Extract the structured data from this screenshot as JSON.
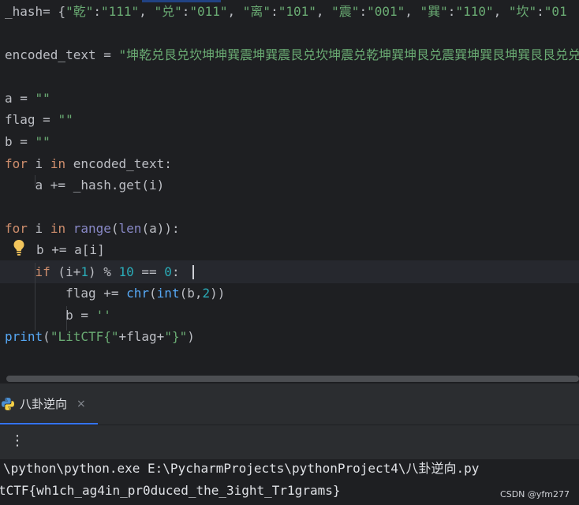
{
  "editor": {
    "lines": {
      "l1": {
        "var": "_hash",
        "op": "= {",
        "k1": "\"乾\"",
        "v1": "\"111\"",
        "k2": "\"兑\"",
        "v2": "\"011\"",
        "k3": "\"离\"",
        "v3": "\"101\"",
        "k4": "\"震\"",
        "v4": "\"001\"",
        "k5": "\"巽\"",
        "v5": "\"110\"",
        "k6": "\"坎\"",
        "v6": "\"01"
      },
      "l2": {
        "var": "encoded_text",
        "op": " = ",
        "value": "\"坤乾兑艮兑坎坤坤巽震坤巽震艮兑坎坤震兑乾坤巽坤艮兑震巽坤巽艮坤巽艮艮兑兑"
      },
      "l3": {
        "var": "a",
        "op": " = ",
        "value": "\"\""
      },
      "l4": {
        "var": "flag",
        "op": " = ",
        "value": "\"\""
      },
      "l5": {
        "var": "b",
        "op": " = ",
        "value": "\"\""
      },
      "l6": {
        "kw1": "for",
        "var": " i ",
        "kw2": "in",
        "rest": " encoded_text:"
      },
      "l7": {
        "text": "    a += _hash.get(i)"
      },
      "l8": {
        "kw1": "for",
        "var": " i ",
        "kw2": "in",
        "sp": " ",
        "fn1": "range",
        "p1": "(",
        "fn2": "len",
        "rest": "(a)):"
      },
      "l9": {
        "text": "b += a[i]"
      },
      "l10": {
        "indent": "    ",
        "kw": "if",
        "p1": " (i+",
        "n1": "1",
        "p2": ") % ",
        "n2": "10",
        "p3": " == ",
        "n3": "0",
        "p4": ":"
      },
      "l11": {
        "indent": "        flag += ",
        "fn1": "chr",
        "p1": "(",
        "fn2": "int",
        "p2": "(b,",
        "n1": "2",
        "p3": "))"
      },
      "l12": {
        "indent": "        b = ",
        "value": "''"
      },
      "l13": {
        "fn": "print",
        "p1": "(",
        "s1": "\"LitCTF{\"",
        "p2": "+flag+",
        "s2": "\"}\"",
        "p3": ")"
      }
    }
  },
  "run_panel": {
    "tab_label": "八卦逆向",
    "tab_close": "×",
    "menu_glyph": "⋮",
    "console_lines": [
      "\\python\\python.exe E:\\PycharmProjects\\pythonProject4\\八卦逆向.py",
      "tCTF{wh1ch_ag4in_pr0duced_the_3ight_Tr1grams}"
    ]
  },
  "watermark": "CSDN @yfm277",
  "colors": {
    "editor_bg": "#1e1f22",
    "panel_bg": "#2b2d30",
    "keyword": "#cf8e6d",
    "string": "#6aab73",
    "number": "#2aacb8",
    "function": "#56a8f5",
    "builtin": "#8888c6",
    "accent": "#3574f0"
  },
  "icons": {
    "bulb": "lightbulb-icon",
    "python": "python-icon",
    "close": "close-icon",
    "more": "more-vertical-icon"
  }
}
